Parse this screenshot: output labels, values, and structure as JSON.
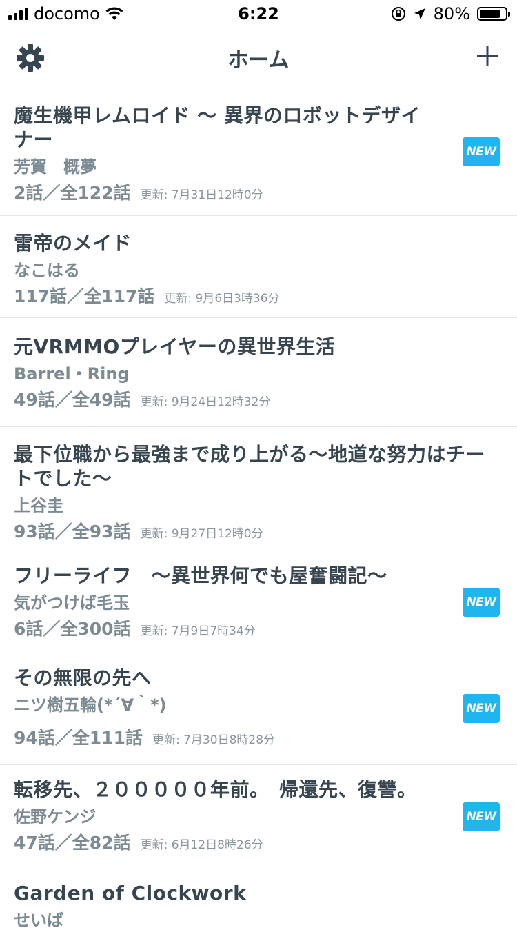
{
  "status_bar": {
    "carrier": "docomo",
    "time": "6:22",
    "battery": "80%",
    "battery_level": 0.8
  },
  "nav": {
    "title": "ホーム",
    "settings_icon": "gear-icon",
    "add_icon": "plus-icon"
  },
  "new_badge_label": "NEW",
  "updated_prefix": "更新:",
  "items": [
    {
      "title": "魔生機甲レムロイド 〜 異界のロボットデザイナー",
      "author": "芳賀　概夢",
      "episodes": "2話／全122話",
      "updated": "更新: 7月31日12時0分",
      "new": true
    },
    {
      "title": "雷帝のメイド",
      "author": "なこはる",
      "episodes": "117話／全117話",
      "updated": "更新: 9月6日3時36分",
      "new": false
    },
    {
      "title": "元VRMMOプレイヤーの異世界生活",
      "author": "Barrel・Ring",
      "episodes": "49話／全49話",
      "updated": "更新: 9月24日12時32分",
      "new": false
    },
    {
      "title": "最下位職から最強まで成り上がる〜地道な努力はチートでした〜",
      "author": "上谷圭",
      "episodes": "93話／全93話",
      "updated": "更新: 9月27日12時0分",
      "new": false
    },
    {
      "title": "フリーライフ　〜異世界何でも屋奮闘記〜",
      "author": "気がつけば毛玉",
      "episodes": "6話／全300話",
      "updated": "更新: 7月9日7時34分",
      "new": true
    },
    {
      "title": "その無限の先へ",
      "author": "ニツ樹五輪(*´∀｀*)",
      "episodes": "94話／全111話",
      "updated": "更新: 7月30日8時28分",
      "new": true
    },
    {
      "title": "転移先、２０００００年前。　帰還先、復讐。",
      "author": "佐野ケンジ",
      "episodes": "47話／全82話",
      "updated": "更新: 6月12日8時26分",
      "new": true
    },
    {
      "title": "Garden of Clockwork",
      "author": "せいば",
      "episodes": "",
      "updated": "",
      "new": false
    }
  ]
}
